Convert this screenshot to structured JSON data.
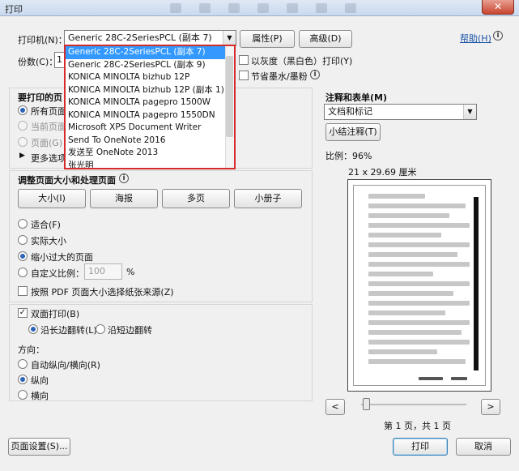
{
  "window": {
    "title": "打印",
    "close_label": "✕"
  },
  "printer": {
    "label": "打印机(N)：",
    "selected": "Generic 28C-2SeriesPCL (副本 7)",
    "properties_button": "属性(P)",
    "advanced_button": "高级(D)",
    "help_link": "帮助(H)",
    "options": [
      "Generic 28C-2SeriesPCL (副本 7)",
      "Generic 28C-2SeriesPCL (副本 9)",
      "KONICA MINOLTA bizhub 12P",
      "KONICA MINOLTA bizhub 12P (副本 1)",
      "KONICA MINOLTA pagepro 1500W",
      "KONICA MINOLTA pagepro 1550DN",
      "Microsoft XPS Document Writer",
      "Send To OneNote 2016",
      "发送至 OneNote 2013",
      "张光明"
    ]
  },
  "copies": {
    "label": "份数(C)：",
    "value": "1"
  },
  "grayscale_label": "以灰度（黑白色）打印(Y)",
  "save_ink_label": "节省墨水/墨粉",
  "pages_to_print": {
    "title": "要打印的页",
    "all_label": "所有页面",
    "current_label": "当前页面",
    "pages_label": "页面(G)",
    "more_label": "更多选项"
  },
  "sizing": {
    "title": "调整页面大小和处理页面",
    "size_button": "大小(I)",
    "poster_button": "海报",
    "multiple_button": "多页",
    "booklet_button": "小册子",
    "fit_label": "适合(F)",
    "actual_label": "实际大小",
    "shrink_label": "缩小过大的页面",
    "custom_label": "自定义比例：",
    "custom_value": "100",
    "percent": "%",
    "paper_source_label": "按照 PDF 页面大小选择纸张来源(Z)"
  },
  "duplex": {
    "label": "双面打印(B)",
    "long_edge_label": "沿长边翻转(L)",
    "short_edge_label": "沿短边翻转"
  },
  "orientation": {
    "title": "方向：",
    "auto_label": "自动纵向/横向(R)",
    "portrait_label": "纵向",
    "landscape_label": "横向"
  },
  "comments": {
    "title": "注释和表单(M)",
    "selected": "文档和标记",
    "summarize_button": "小结注释(T)"
  },
  "preview": {
    "scale_label": "比例：96%",
    "size_label": "21 x 29.69 厘米",
    "prev_label": "<",
    "next_label": ">",
    "page_info": "第 1 页，共 1 页"
  },
  "footer": {
    "page_setup_button": "页面设置(S)...",
    "print_button": "打印",
    "cancel_button": "取消"
  }
}
